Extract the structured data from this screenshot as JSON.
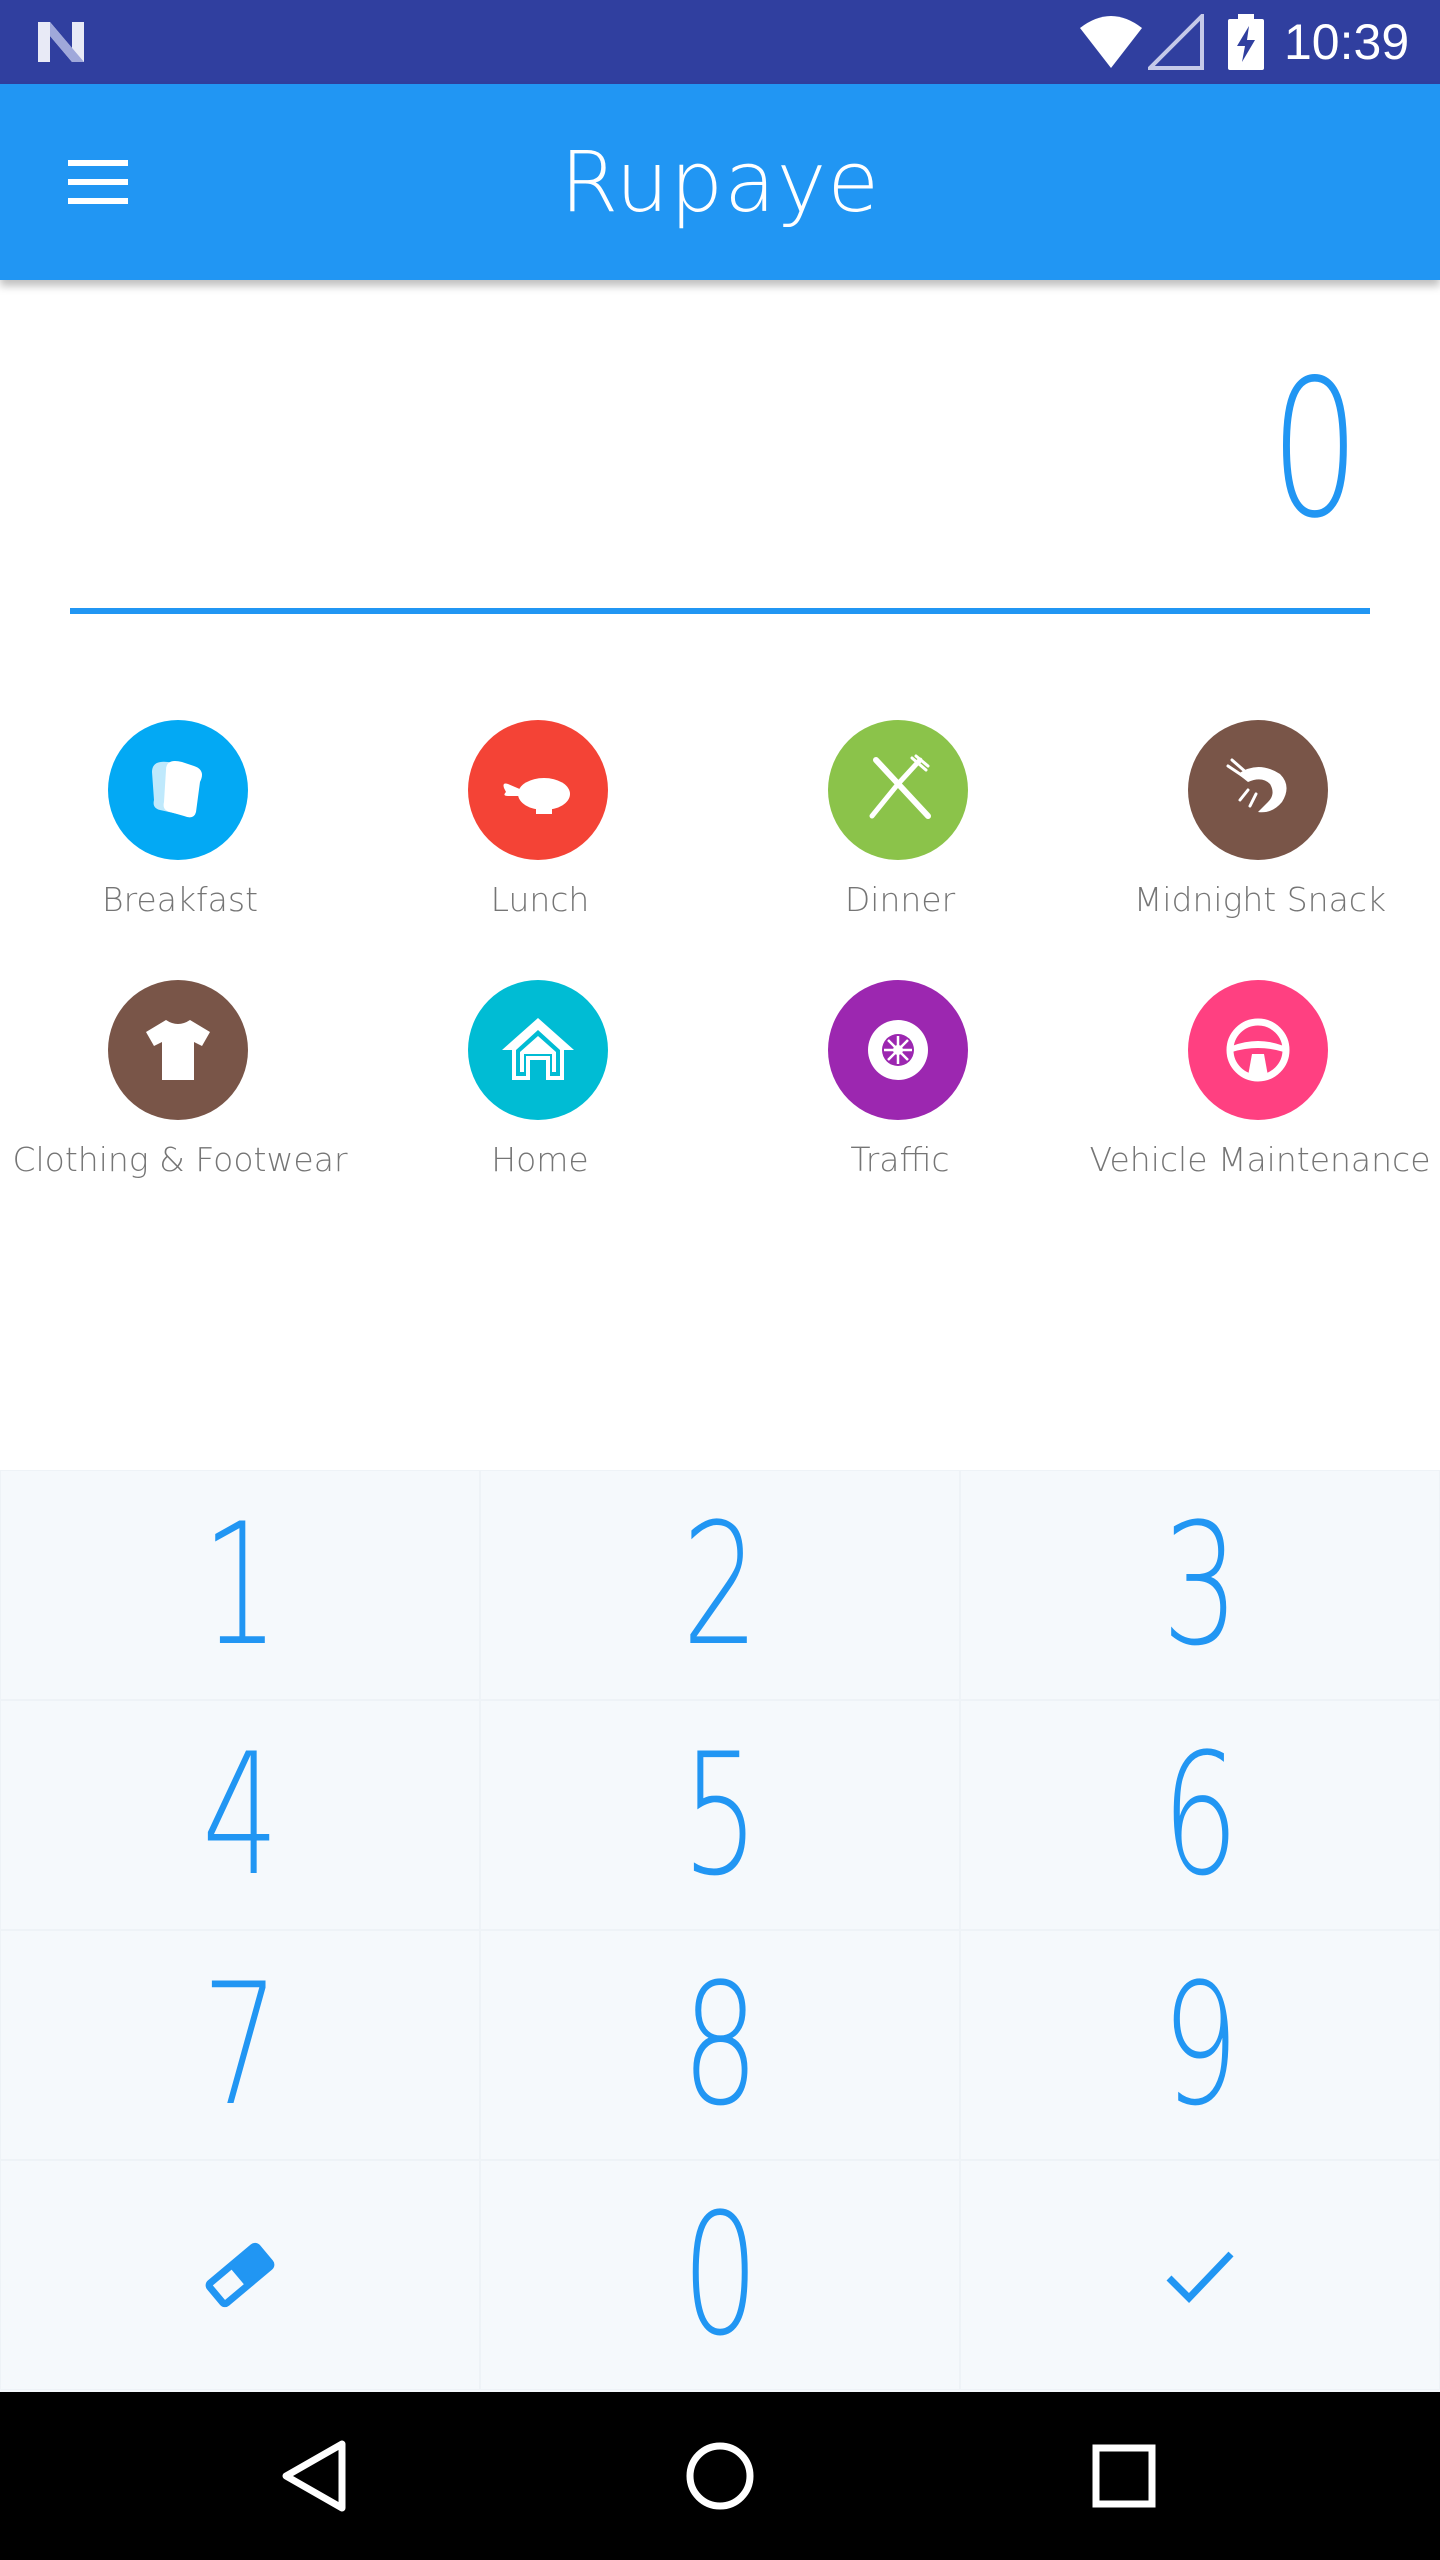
{
  "status_bar": {
    "time": "10:39"
  },
  "app_bar": {
    "title": "Rupaye",
    "menu_icon": "menu-icon"
  },
  "amount": {
    "value": "0"
  },
  "categories": [
    {
      "label": "Breakfast",
      "icon": "bread-icon",
      "color": "#03A9F4"
    },
    {
      "label": "Lunch",
      "icon": "chicken-icon",
      "color": "#F44336"
    },
    {
      "label": "Dinner",
      "icon": "fork-knife-icon",
      "color": "#8BC34A"
    },
    {
      "label": "Midnight Snack",
      "icon": "shrimp-icon",
      "color": "#795548"
    },
    {
      "label": "Clothing & Footwear",
      "icon": "tshirt-icon",
      "color": "#795548"
    },
    {
      "label": "Home",
      "icon": "house-icon",
      "color": "#00BCD4"
    },
    {
      "label": "Traffic",
      "icon": "wheel-icon",
      "color": "#9C27B0"
    },
    {
      "label": "Vehicle Maintenance",
      "icon": "steering-wheel-icon",
      "color": "#FF4081"
    }
  ],
  "keypad": {
    "keys": [
      "1",
      "2",
      "3",
      "4",
      "5",
      "6",
      "7",
      "8",
      "9",
      "0"
    ],
    "clear_icon": "eraser-icon",
    "confirm_icon": "check-icon"
  },
  "colors": {
    "primary": "#2196F3",
    "primary_dark": "#303F9F",
    "keypad_bg": "#F5F9FC"
  },
  "nav_bar": {
    "back_icon": "back-icon",
    "home_icon": "home-circle-icon",
    "recents_icon": "recents-square-icon"
  }
}
